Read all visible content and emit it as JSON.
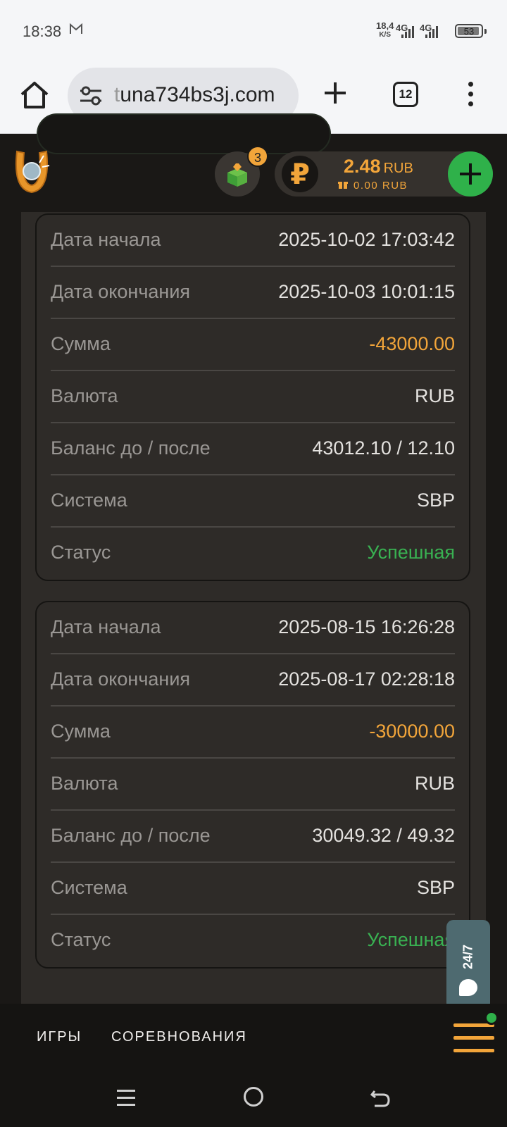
{
  "status_bar": {
    "time": "18:38",
    "notification_icon": "gmail-icon",
    "speed_value": "18,4",
    "speed_unit": "K/S",
    "net1": "4G",
    "net2": "4G",
    "battery": "53"
  },
  "browser": {
    "url_dim_prefix": "t",
    "url_rest": "una734bs3j.com",
    "tab_count": "12"
  },
  "header": {
    "gift_count": "3",
    "balance_value": "2.48",
    "balance_currency": "RUB",
    "bonus_balance": "0.00 RUB",
    "ruble_symbol": "₽"
  },
  "transactions": [
    {
      "rows": [
        {
          "label": "Дата начала",
          "value": "2025-10-02 17:03:42"
        },
        {
          "label": "Дата окончания",
          "value": "2025-10-03 10:01:15"
        },
        {
          "label": "Сумма",
          "value": "-43000.00"
        },
        {
          "label": "Валюта",
          "value": "RUB"
        },
        {
          "label": "Баланс до / после",
          "value": "43012.10 / 12.10"
        },
        {
          "label": "Система",
          "value": "SBP"
        },
        {
          "label": "Статус",
          "value": "Успешная"
        }
      ]
    },
    {
      "rows": [
        {
          "label": "Дата начала",
          "value": "2025-08-15 16:26:28"
        },
        {
          "label": "Дата окончания",
          "value": "2025-08-17 02:28:18"
        },
        {
          "label": "Сумма",
          "value": "-30000.00"
        },
        {
          "label": "Валюта",
          "value": "RUB"
        },
        {
          "label": "Баланс до / после",
          "value": "30049.32 / 49.32"
        },
        {
          "label": "Система",
          "value": "SBP"
        },
        {
          "label": "Статус",
          "value": "Успешная"
        }
      ]
    }
  ],
  "support": {
    "label": "24/7"
  },
  "site_nav": {
    "games": "ИГРЫ",
    "tournaments": "СОРЕВНОВАНИЯ"
  },
  "colors": {
    "accent": "#f2a53a",
    "success": "#39b152",
    "plus_button": "#2fb14a",
    "panel": "#2e2b28"
  }
}
